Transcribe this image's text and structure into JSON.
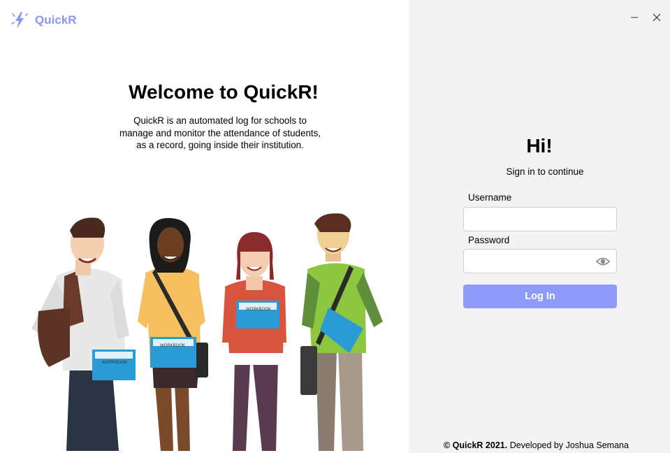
{
  "app": {
    "name": "QuickR",
    "accent": "#8b96f0"
  },
  "welcome": {
    "title": "Welcome to QuickR!",
    "lines": [
      "QuickR is an automated log for schools to",
      "manage and monitor the attendance of students,",
      "as a record, going inside their institution."
    ]
  },
  "illustration": {
    "book_label": "WORKBOOK"
  },
  "window": {
    "minimize_icon": "minimize-icon",
    "close_icon": "close-icon"
  },
  "login": {
    "greeting": "Hi!",
    "subtitle": "Sign in to continue",
    "username_label": "Username",
    "username_value": "",
    "password_label": "Password",
    "password_value": "",
    "show_password_icon": "eye-icon",
    "button_label": "Log In",
    "button_color": "#8e9bfa"
  },
  "footer": {
    "copyright": "© QuickR 2021.",
    "developer": "Developed by Joshua Semana"
  }
}
